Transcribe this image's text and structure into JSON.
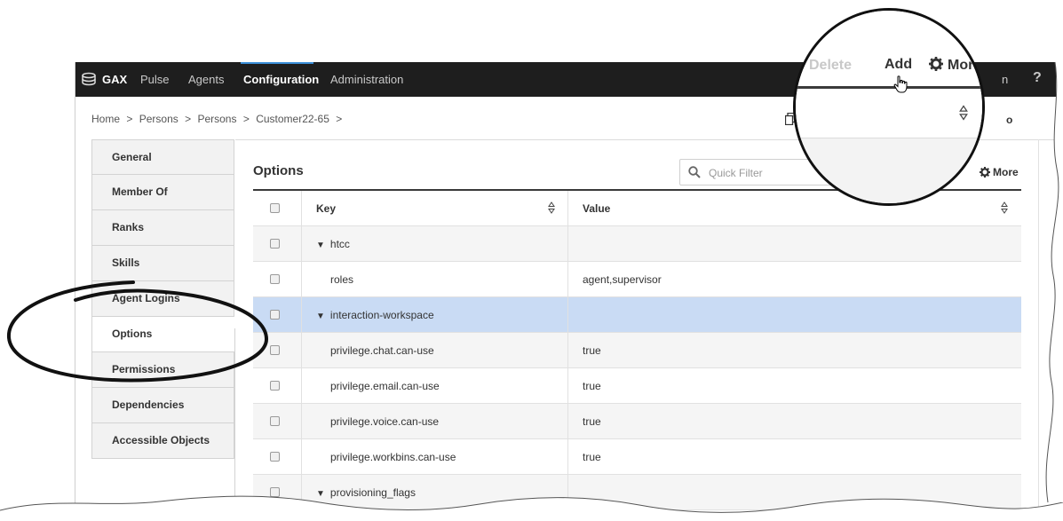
{
  "topnav": {
    "brand": "GAX",
    "items": [
      "Pulse",
      "Agents",
      "Configuration",
      "Administration"
    ],
    "active": "Configuration",
    "user_fragment": "n",
    "help": "?"
  },
  "breadcrumb": [
    "Home",
    ">",
    "Persons",
    ">",
    "Persons",
    ">",
    "Customer22-65",
    ">"
  ],
  "breadcrumb_right_fragment": "o",
  "sidebar": {
    "items": [
      {
        "label": "General"
      },
      {
        "label": "Member Of"
      },
      {
        "label": "Ranks"
      },
      {
        "label": "Skills"
      },
      {
        "label": "Agent Logins"
      },
      {
        "label": "Options"
      },
      {
        "label": "Permissions"
      },
      {
        "label": "Dependencies"
      },
      {
        "label": "Accessible Objects"
      }
    ],
    "active": "Options"
  },
  "options": {
    "title": "Options",
    "quick_filter_placeholder": "Quick Filter",
    "more_label": "More"
  },
  "grid": {
    "columns": [
      "Key",
      "Value"
    ],
    "rows": [
      {
        "key": "htcc",
        "value": "",
        "expanded": true
      },
      {
        "key": "roles",
        "value": "agent,supervisor"
      },
      {
        "key": "interaction-workspace",
        "value": "",
        "expanded": true,
        "selected": true
      },
      {
        "key": "privilege.chat.can-use",
        "value": "true"
      },
      {
        "key": "privilege.email.can-use",
        "value": "true"
      },
      {
        "key": "privilege.voice.can-use",
        "value": "true"
      },
      {
        "key": "privilege.workbins.can-use",
        "value": "true"
      },
      {
        "key": "provisioning_flags",
        "value": "",
        "expanded": true
      }
    ]
  },
  "zoom": {
    "delete_label": "Delete",
    "add_label": "Add",
    "more_label": "More"
  },
  "colors": {
    "nav_bg": "#1e1e1e",
    "active_tab_line": "#3b8fd8",
    "selected_row": "#c9dbf4",
    "annotation": "#111111"
  },
  "icons": [
    "database-logo-icon",
    "copy-icon",
    "search-icon",
    "gear-icon",
    "sort-icon",
    "hand-cursor-icon"
  ]
}
